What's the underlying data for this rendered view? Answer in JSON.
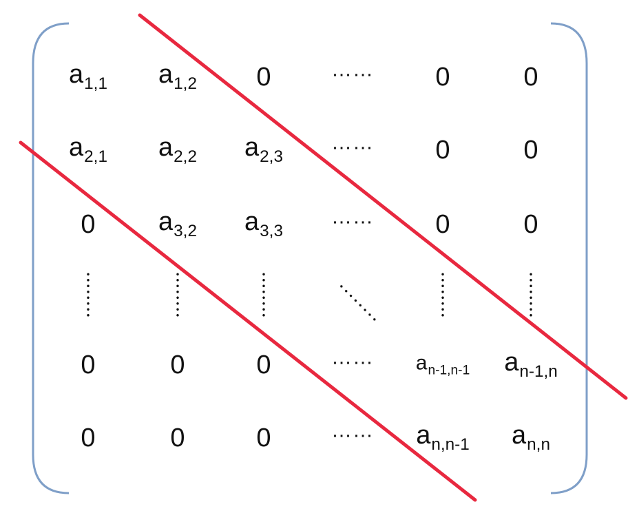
{
  "matrix": {
    "rows": [
      [
        {
          "kind": "entry",
          "base": "a",
          "sub": "1,1"
        },
        {
          "kind": "entry",
          "base": "a",
          "sub": "1,2"
        },
        {
          "kind": "zero",
          "text": "0"
        },
        {
          "kind": "hdots",
          "text": "……"
        },
        {
          "kind": "zero",
          "text": "0"
        },
        {
          "kind": "zero",
          "text": "0"
        }
      ],
      [
        {
          "kind": "entry",
          "base": "a",
          "sub": "2,1"
        },
        {
          "kind": "entry",
          "base": "a",
          "sub": "2,2"
        },
        {
          "kind": "entry",
          "base": "a",
          "sub": "2,3"
        },
        {
          "kind": "hdots",
          "text": "……"
        },
        {
          "kind": "zero",
          "text": "0"
        },
        {
          "kind": "zero",
          "text": "0"
        }
      ],
      [
        {
          "kind": "zero",
          "text": "0"
        },
        {
          "kind": "entry",
          "base": "a",
          "sub": "3,2"
        },
        {
          "kind": "entry",
          "base": "a",
          "sub": "3,3"
        },
        {
          "kind": "hdots",
          "text": "……"
        },
        {
          "kind": "zero",
          "text": "0"
        },
        {
          "kind": "zero",
          "text": "0"
        }
      ],
      [
        {
          "kind": "vdots"
        },
        {
          "kind": "vdots"
        },
        {
          "kind": "vdots"
        },
        {
          "kind": "ddots"
        },
        {
          "kind": "vdots"
        },
        {
          "kind": "vdots"
        }
      ],
      [
        {
          "kind": "zero",
          "text": "0"
        },
        {
          "kind": "zero",
          "text": "0"
        },
        {
          "kind": "zero",
          "text": "0"
        },
        {
          "kind": "hdots",
          "text": "……"
        },
        {
          "kind": "entry",
          "base": "a",
          "sub": "n-1,n-1",
          "small": true
        },
        {
          "kind": "entry",
          "base": "a",
          "sub": "n-1,n"
        }
      ],
      [
        {
          "kind": "zero",
          "text": "0"
        },
        {
          "kind": "zero",
          "text": "0"
        },
        {
          "kind": "zero",
          "text": "0"
        },
        {
          "kind": "hdots",
          "text": "……"
        },
        {
          "kind": "entry",
          "base": "a",
          "sub": "n,n-1"
        },
        {
          "kind": "entry",
          "base": "a",
          "sub": "n,n"
        }
      ]
    ]
  },
  "colors": {
    "bracket": "#7f9fc8",
    "band_line": "#e8283f",
    "text": "#111111"
  }
}
